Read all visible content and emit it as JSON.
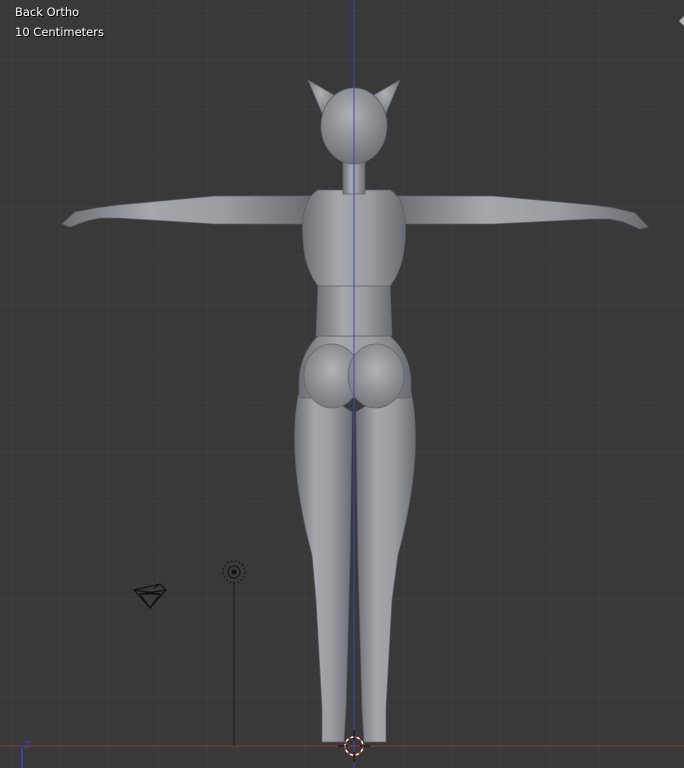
{
  "viewport": {
    "view_name": "Back Ortho",
    "grid_scale": "10 Centimeters"
  },
  "axes": {
    "vertical_axis": "Z",
    "vertical_axis_color": "#3d45c4",
    "horizontal_axis_color": "#8c3a3a"
  },
  "colors": {
    "background": "#393939",
    "grid_minor": "#404040",
    "mesh": "#9a9ba0"
  },
  "icons": {
    "camera": "camera-icon",
    "light": "lamp-icon",
    "cursor": "3d-cursor-icon"
  }
}
